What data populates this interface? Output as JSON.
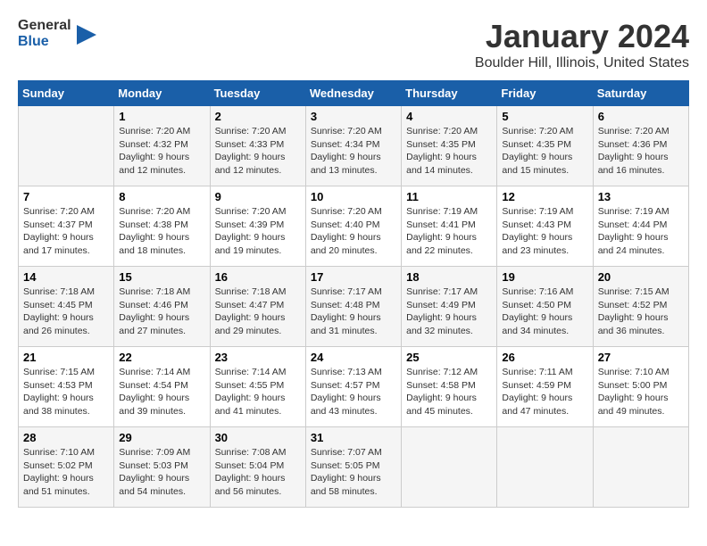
{
  "logo": {
    "line1": "General",
    "line2": "Blue"
  },
  "title": "January 2024",
  "subtitle": "Boulder Hill, Illinois, United States",
  "days_of_week": [
    "Sunday",
    "Monday",
    "Tuesday",
    "Wednesday",
    "Thursday",
    "Friday",
    "Saturday"
  ],
  "weeks": [
    [
      {
        "day": "",
        "info": ""
      },
      {
        "day": "1",
        "info": "Sunrise: 7:20 AM\nSunset: 4:32 PM\nDaylight: 9 hours\nand 12 minutes."
      },
      {
        "day": "2",
        "info": "Sunrise: 7:20 AM\nSunset: 4:33 PM\nDaylight: 9 hours\nand 12 minutes."
      },
      {
        "day": "3",
        "info": "Sunrise: 7:20 AM\nSunset: 4:34 PM\nDaylight: 9 hours\nand 13 minutes."
      },
      {
        "day": "4",
        "info": "Sunrise: 7:20 AM\nSunset: 4:35 PM\nDaylight: 9 hours\nand 14 minutes."
      },
      {
        "day": "5",
        "info": "Sunrise: 7:20 AM\nSunset: 4:35 PM\nDaylight: 9 hours\nand 15 minutes."
      },
      {
        "day": "6",
        "info": "Sunrise: 7:20 AM\nSunset: 4:36 PM\nDaylight: 9 hours\nand 16 minutes."
      }
    ],
    [
      {
        "day": "7",
        "info": "Sunrise: 7:20 AM\nSunset: 4:37 PM\nDaylight: 9 hours\nand 17 minutes."
      },
      {
        "day": "8",
        "info": "Sunrise: 7:20 AM\nSunset: 4:38 PM\nDaylight: 9 hours\nand 18 minutes."
      },
      {
        "day": "9",
        "info": "Sunrise: 7:20 AM\nSunset: 4:39 PM\nDaylight: 9 hours\nand 19 minutes."
      },
      {
        "day": "10",
        "info": "Sunrise: 7:20 AM\nSunset: 4:40 PM\nDaylight: 9 hours\nand 20 minutes."
      },
      {
        "day": "11",
        "info": "Sunrise: 7:19 AM\nSunset: 4:41 PM\nDaylight: 9 hours\nand 22 minutes."
      },
      {
        "day": "12",
        "info": "Sunrise: 7:19 AM\nSunset: 4:43 PM\nDaylight: 9 hours\nand 23 minutes."
      },
      {
        "day": "13",
        "info": "Sunrise: 7:19 AM\nSunset: 4:44 PM\nDaylight: 9 hours\nand 24 minutes."
      }
    ],
    [
      {
        "day": "14",
        "info": "Sunrise: 7:18 AM\nSunset: 4:45 PM\nDaylight: 9 hours\nand 26 minutes."
      },
      {
        "day": "15",
        "info": "Sunrise: 7:18 AM\nSunset: 4:46 PM\nDaylight: 9 hours\nand 27 minutes."
      },
      {
        "day": "16",
        "info": "Sunrise: 7:18 AM\nSunset: 4:47 PM\nDaylight: 9 hours\nand 29 minutes."
      },
      {
        "day": "17",
        "info": "Sunrise: 7:17 AM\nSunset: 4:48 PM\nDaylight: 9 hours\nand 31 minutes."
      },
      {
        "day": "18",
        "info": "Sunrise: 7:17 AM\nSunset: 4:49 PM\nDaylight: 9 hours\nand 32 minutes."
      },
      {
        "day": "19",
        "info": "Sunrise: 7:16 AM\nSunset: 4:50 PM\nDaylight: 9 hours\nand 34 minutes."
      },
      {
        "day": "20",
        "info": "Sunrise: 7:15 AM\nSunset: 4:52 PM\nDaylight: 9 hours\nand 36 minutes."
      }
    ],
    [
      {
        "day": "21",
        "info": "Sunrise: 7:15 AM\nSunset: 4:53 PM\nDaylight: 9 hours\nand 38 minutes."
      },
      {
        "day": "22",
        "info": "Sunrise: 7:14 AM\nSunset: 4:54 PM\nDaylight: 9 hours\nand 39 minutes."
      },
      {
        "day": "23",
        "info": "Sunrise: 7:14 AM\nSunset: 4:55 PM\nDaylight: 9 hours\nand 41 minutes."
      },
      {
        "day": "24",
        "info": "Sunrise: 7:13 AM\nSunset: 4:57 PM\nDaylight: 9 hours\nand 43 minutes."
      },
      {
        "day": "25",
        "info": "Sunrise: 7:12 AM\nSunset: 4:58 PM\nDaylight: 9 hours\nand 45 minutes."
      },
      {
        "day": "26",
        "info": "Sunrise: 7:11 AM\nSunset: 4:59 PM\nDaylight: 9 hours\nand 47 minutes."
      },
      {
        "day": "27",
        "info": "Sunrise: 7:10 AM\nSunset: 5:00 PM\nDaylight: 9 hours\nand 49 minutes."
      }
    ],
    [
      {
        "day": "28",
        "info": "Sunrise: 7:10 AM\nSunset: 5:02 PM\nDaylight: 9 hours\nand 51 minutes."
      },
      {
        "day": "29",
        "info": "Sunrise: 7:09 AM\nSunset: 5:03 PM\nDaylight: 9 hours\nand 54 minutes."
      },
      {
        "day": "30",
        "info": "Sunrise: 7:08 AM\nSunset: 5:04 PM\nDaylight: 9 hours\nand 56 minutes."
      },
      {
        "day": "31",
        "info": "Sunrise: 7:07 AM\nSunset: 5:05 PM\nDaylight: 9 hours\nand 58 minutes."
      },
      {
        "day": "",
        "info": ""
      },
      {
        "day": "",
        "info": ""
      },
      {
        "day": "",
        "info": ""
      }
    ]
  ]
}
